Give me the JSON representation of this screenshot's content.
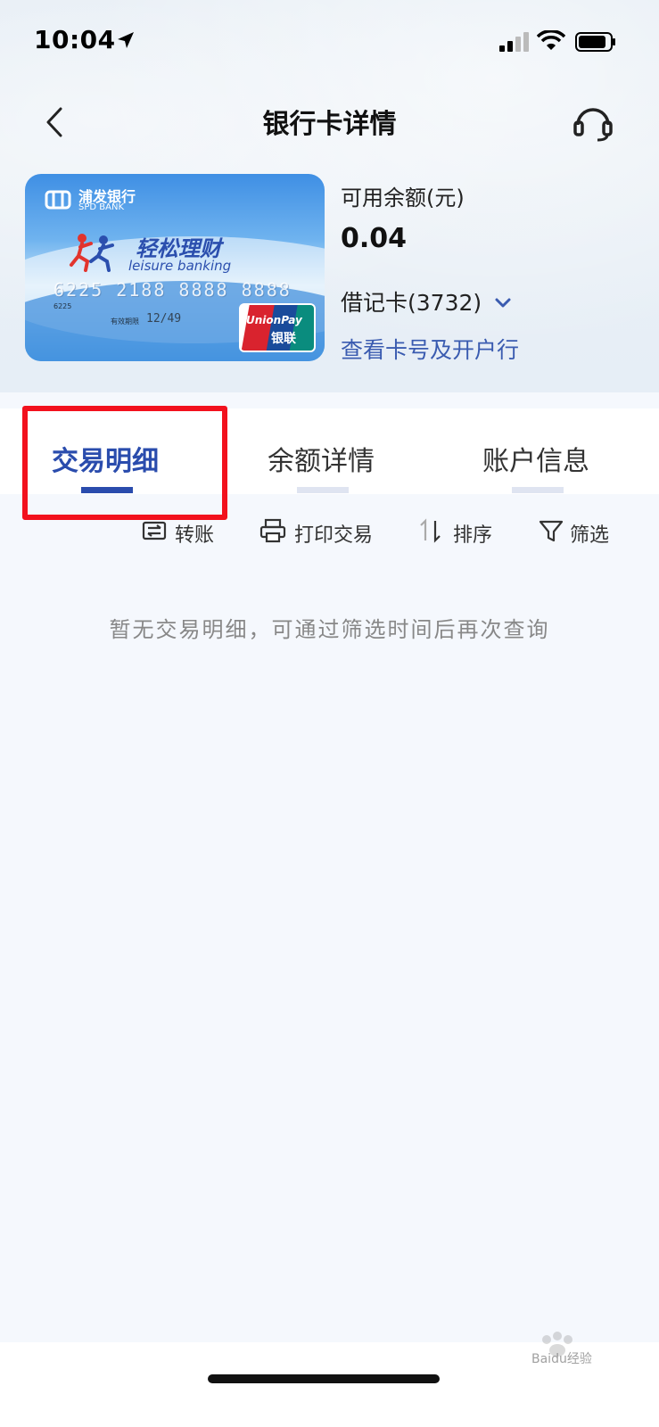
{
  "status_bar": {
    "time": "10:04",
    "icons": [
      "location-arrow-icon",
      "cellular-signal-icon",
      "wifi-icon",
      "battery-icon"
    ]
  },
  "nav": {
    "title": "银行卡详情",
    "back_icon": "back-chevron-icon",
    "service_icon": "headset-icon"
  },
  "card": {
    "bank_name": "浦发银行",
    "bank_name_en": "SPD BANK",
    "product_name": "轻松理财",
    "product_name_en": "leisure banking",
    "number": "6225 2188 8888 8888",
    "prefix": "6225",
    "expiry_label": "有效期限",
    "expiry": "12/49",
    "network": "UnionPay",
    "network_cn": "银联"
  },
  "account": {
    "balance_label": "可用余额(元)",
    "balance": "0.04",
    "card_type": "借记卡(3732)",
    "view_card_link": "查看卡号及开户行"
  },
  "tabs": [
    {
      "label": "交易明细",
      "active": true
    },
    {
      "label": "余额详情",
      "active": false
    },
    {
      "label": "账户信息",
      "active": false
    }
  ],
  "actions": [
    {
      "label": "转账",
      "icon": "transfer-icon"
    },
    {
      "label": "打印交易",
      "icon": "printer-icon"
    },
    {
      "label": "排序",
      "icon": "sort-icon"
    },
    {
      "label": "筛选",
      "icon": "filter-icon"
    }
  ],
  "empty_message": "暂无交易明细，可通过筛选时间后再次查询",
  "watermark": "Baidu经验",
  "colors": {
    "accent": "#2a4cad",
    "link": "#3a5bb0",
    "highlight_box": "#f2111d"
  }
}
